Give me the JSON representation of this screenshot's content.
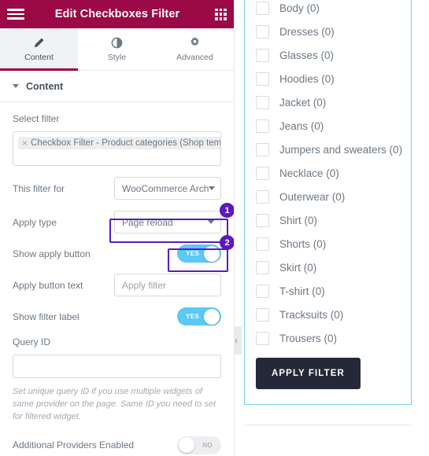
{
  "panel": {
    "header": {
      "title": "Edit Checkboxes Filter",
      "menu_icon": "hamburger-icon",
      "grid_icon": "grid-icon"
    },
    "tabs": [
      {
        "label": "Content",
        "icon": "pencil-icon",
        "active": true
      },
      {
        "label": "Style",
        "icon": "contrast-circle-icon",
        "active": false
      },
      {
        "label": "Advanced",
        "icon": "gear-icon",
        "active": false
      }
    ],
    "section": {
      "title": "Content"
    },
    "fields": {
      "select_filter_label": "Select filter",
      "select_filter_chip": "Checkbox Filter - Product categories (Shop templa",
      "chip_remove": "×",
      "this_filter_for_label": "This filter for",
      "this_filter_for_value": "WooCommerce Arch",
      "apply_type_label": "Apply type",
      "apply_type_value": "Page reload",
      "show_apply_button_label": "Show apply button",
      "show_apply_button_state": "YES",
      "apply_button_text_label": "Apply button text",
      "apply_button_text_value": "Apply filter",
      "show_filter_label_label": "Show filter label",
      "show_filter_label_state": "YES",
      "query_id_label": "Query ID",
      "query_id_value": "",
      "query_id_help": "Set unique query ID if you use multiple widgets of same provider on the page. Same ID you need to set for filtered widget.",
      "additional_providers_label": "Additional Providers Enabled",
      "additional_providers_state": "NO"
    },
    "annotations": [
      {
        "number": "1",
        "target": "apply-type-select"
      },
      {
        "number": "2",
        "target": "show-apply-button-toggle"
      }
    ]
  },
  "preview": {
    "checkboxes": [
      {
        "label": "Body (0)",
        "checked": false
      },
      {
        "label": "Dresses (0)",
        "checked": false
      },
      {
        "label": "Glasses (0)",
        "checked": false
      },
      {
        "label": "Hoodies (0)",
        "checked": false
      },
      {
        "label": "Jacket (0)",
        "checked": false
      },
      {
        "label": "Jeans (0)",
        "checked": false
      },
      {
        "label": "Jumpers and sweaters (0)",
        "checked": false
      },
      {
        "label": "Necklace (0)",
        "checked": false
      },
      {
        "label": "Outerwear (0)",
        "checked": false
      },
      {
        "label": "Shirt (0)",
        "checked": false
      },
      {
        "label": "Shorts (0)",
        "checked": false
      },
      {
        "label": "Skirt (0)",
        "checked": false
      },
      {
        "label": "T-shirt (0)",
        "checked": false
      },
      {
        "label": "Tracksuits (0)",
        "checked": false
      },
      {
        "label": "Trousers (0)",
        "checked": false
      }
    ],
    "apply_button_label": "APPLY FILTER",
    "collapse_handle_icon": "‹"
  },
  "colors": {
    "header_crimson": "#9b0a46",
    "annotation_purple": "#5b19c4",
    "toggle_on_blue": "#5bc8f5",
    "widget_outline_cyan": "#71d0ee",
    "apply_button_dark": "#252836"
  }
}
